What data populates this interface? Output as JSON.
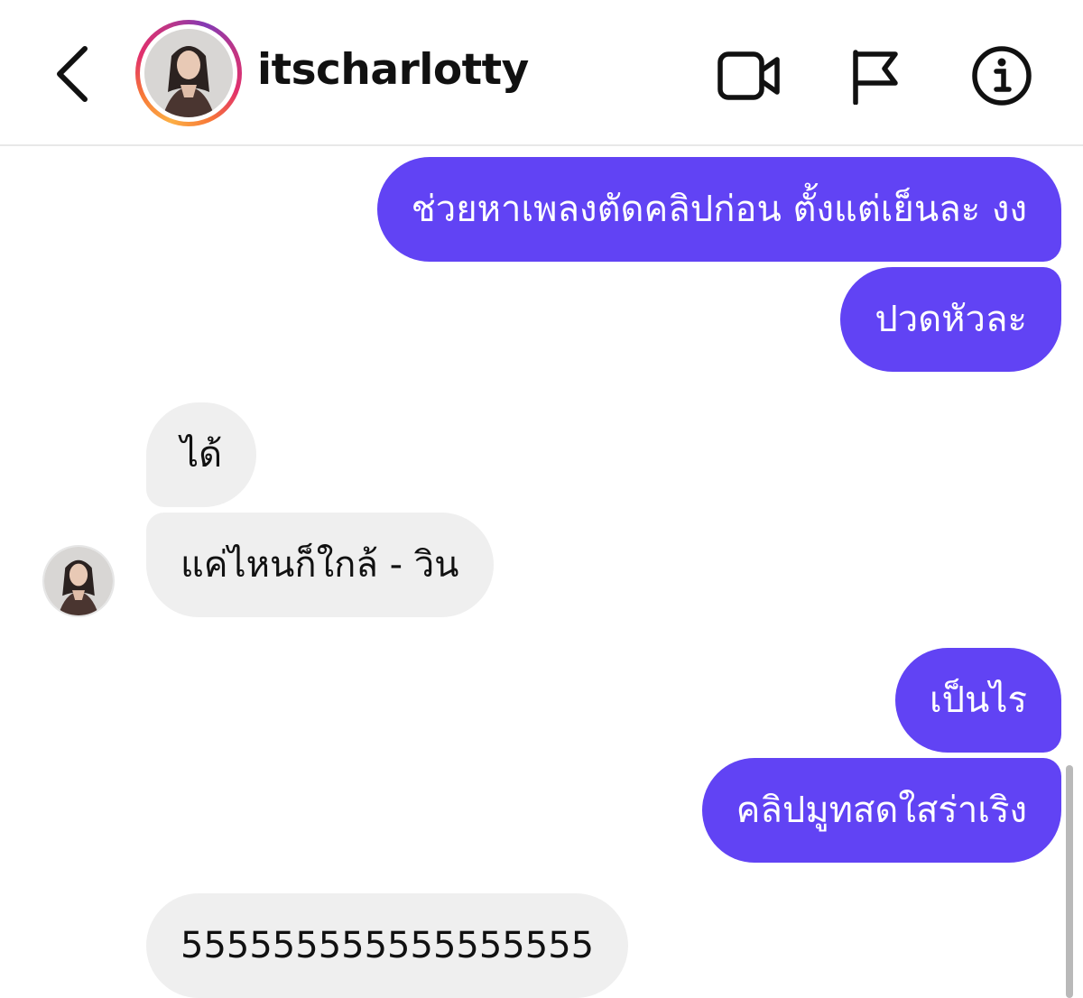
{
  "header": {
    "username": "itscharlotty",
    "icons": {
      "back": "chevron-left-icon",
      "video": "video-camera-icon",
      "report": "flag-icon",
      "info": "info-icon"
    }
  },
  "colors": {
    "outgoing_bubble": "#6143f4",
    "incoming_bubble": "#efefef",
    "ring_gradient": [
      "#fcaf45",
      "#f77737",
      "#e1306c",
      "#c13584",
      "#833ab4"
    ]
  },
  "messages": [
    {
      "sender": "me",
      "text": "ช่วยหาเพลงตัดคลิปก่อน ตั้งแต่เย็นละ งง"
    },
    {
      "sender": "me",
      "text": "ปวดหัวละ"
    },
    {
      "sender": "them",
      "text": "ได้"
    },
    {
      "sender": "them",
      "text": "แค่ไหนก็ใกล้ - วิน"
    },
    {
      "sender": "me",
      "text": "เป็นไร"
    },
    {
      "sender": "me",
      "text": "คลิปมูทสดใสร่าเริง"
    },
    {
      "sender": "them",
      "text": "555555555555555555"
    }
  ]
}
